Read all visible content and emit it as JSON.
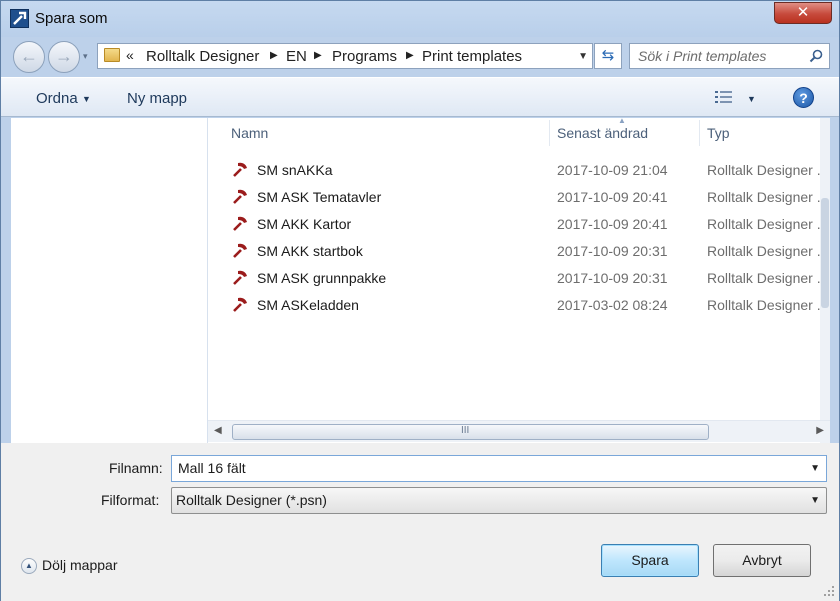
{
  "window": {
    "title": "Spara som",
    "close_symbol": "✕"
  },
  "nav": {
    "back_symbol": "←",
    "forward_symbol": "→",
    "recent_symbol": "▾",
    "overflow_symbol": "«",
    "breadcrumbs": [
      "Rolltalk Designer",
      "EN",
      "Programs",
      "Print templates"
    ],
    "crumb_separator": "▶",
    "dropdown_symbol": "▼",
    "refresh_symbol": "⇆",
    "search_placeholder": "Sök i Print templates"
  },
  "toolbar": {
    "organize_label": "Ordna",
    "organize_caret": "▼",
    "new_folder_label": "Ny mapp",
    "view_caret": "▼",
    "help_symbol": "?"
  },
  "list": {
    "columns": {
      "name": "Namn",
      "modified": "Senast ändrad",
      "type": "Typ"
    },
    "sort_marker": "▲",
    "files": [
      {
        "name": "SM snAKKa",
        "modified": "2017-10-09 21:04",
        "type": "Rolltalk Designer ..."
      },
      {
        "name": "SM ASK Tematavler",
        "modified": "2017-10-09 20:41",
        "type": "Rolltalk Designer ..."
      },
      {
        "name": "SM AKK Kartor",
        "modified": "2017-10-09 20:41",
        "type": "Rolltalk Designer ..."
      },
      {
        "name": "SM AKK startbok",
        "modified": "2017-10-09 20:31",
        "type": "Rolltalk Designer ..."
      },
      {
        "name": "SM ASK grunnpakke",
        "modified": "2017-10-09 20:31",
        "type": "Rolltalk Designer ..."
      },
      {
        "name": "SM ASKeladden",
        "modified": "2017-03-02 08:24",
        "type": "Rolltalk Designer ..."
      }
    ],
    "scroll_left_symbol": "◀",
    "scroll_right_symbol": "▶",
    "scroll_grip": "III"
  },
  "form": {
    "filename_label": "Filnamn:",
    "filename_value": "Mall 16 fält",
    "format_label": "Filformat:",
    "format_value": "Rolltalk Designer (*.psn)",
    "dropdown_symbol": "▼"
  },
  "footer": {
    "hide_folders_label": "Dölj mappar",
    "hide_folders_symbol": "▲",
    "save_label": "Spara",
    "cancel_label": "Avbryt"
  },
  "colors": {
    "accent": "#1f4f8d",
    "file_icon": "#9b1c1c",
    "title_bar": "#bfd4ee"
  }
}
